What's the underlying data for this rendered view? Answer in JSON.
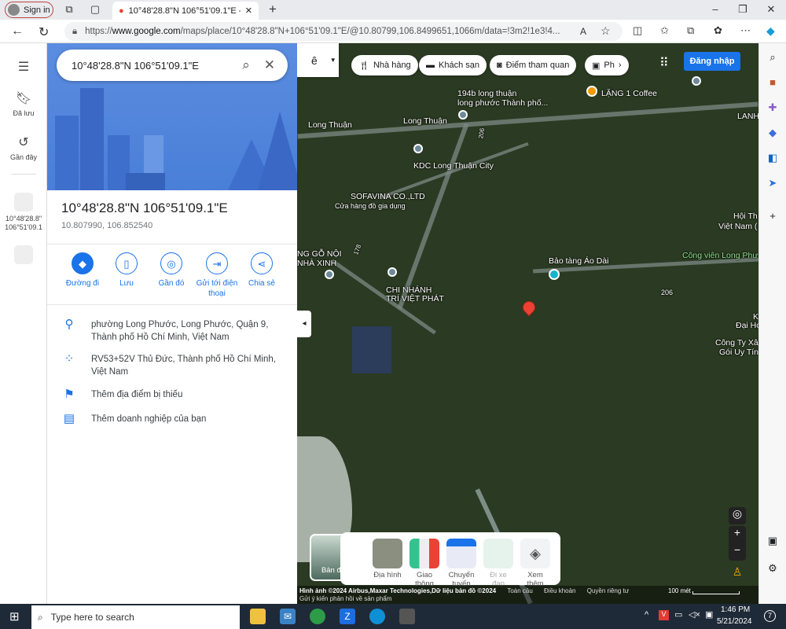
{
  "browser": {
    "signin": "Sign in",
    "tab_title": "10°48'28.8\"N 106°51'09.1\"E - Goo",
    "url_prefix": "https://",
    "url_domain": "www.google.com",
    "url_rest": "/maps/place/10°48'28.8\"N+106°51'09.1\"E/@10.80799,106.8499651,1066m/data=!3m2!1e3!4..."
  },
  "rail": {
    "saved": "Đã lưu",
    "recent": "Gần đây",
    "recent_item": "10°48'28.8\" 106°51'09.1"
  },
  "search": {
    "value": "10°48'28.8\"N 106°51'09.1\"E"
  },
  "place": {
    "title": "10°48'28.8\"N 106°51'09.1\"E",
    "coords": "10.807990, 106.852540"
  },
  "actions": [
    {
      "label": "Đường đi",
      "icon": "directions-icon"
    },
    {
      "label": "Lưu",
      "icon": "bookmark-icon"
    },
    {
      "label": "Gần đó",
      "icon": "nearby-icon"
    },
    {
      "label": "Gửi tới điện thoại",
      "icon": "send-to-phone-icon"
    },
    {
      "label": "Chia sẻ",
      "icon": "share-icon"
    }
  ],
  "info": {
    "address": "phường Long Phước, Long Phước, Quận 9, Thành phố Hồ Chí Minh, Việt Nam",
    "pluscode": "RV53+52V Thủ Đức, Thành phố Hồ Chí Minh, Việt Nam",
    "add_place": "Thêm địa điểm bị thiếu",
    "add_business": "Thêm doanh nghiệp của bạn"
  },
  "map": {
    "lang_btn": "ê",
    "chips": [
      "Nhà hàng",
      "Khách sạn",
      "Điểm tham quan",
      "Ph"
    ],
    "login": "Đăng nhập",
    "labels": {
      "l1": "194b long thuận",
      "l2": "long phước Thành phố...",
      "coffee": "LẶNG 1 Coffee",
      "lt1": "Long Thuận",
      "lt2": "Long Thuận",
      "kdc": "KDC Long Thuận City",
      "sofa": "SOFAVINA CO.,LTD",
      "sofa2": "Cửa hàng đồ gia dụng",
      "r206a": "206",
      "r206b": "206",
      "r178": "178",
      "go": "NG GỖ NỘI",
      "xinh": "NHÀ XINH",
      "cn": "CHI NHÁNH",
      "tvp": "TRÍ VIỆT PHÁT",
      "bt": "Bảo tàng Áo Dài",
      "cv": "Công viên Long Phư",
      "hoi": "Hội Th",
      "vn": "Việt Nam (",
      "lanh": "LANH",
      "dai": "Đại Họ",
      "cty": "Công Ty Xâ",
      "goi": "Gói Uy Tín",
      "k": "K"
    },
    "basemap": "Bản đồ",
    "layers": [
      "Địa hình",
      "Giao thông",
      "Chuyển tuyến",
      "Đi xe đạp",
      "Xem thêm"
    ],
    "attribution": "Hình ảnh ©2024 Airbus,Maxar Technologies,Dữ liệu bản đồ ©2024",
    "links": [
      "Toàn cầu",
      "Điều khoản",
      "Quyền riêng tư"
    ],
    "feedback": "Gửi ý kiến phản hồi về sản phẩm",
    "scale": "100 mét"
  },
  "taskbar": {
    "search_placeholder": "Type here to search",
    "time": "1:46 PM",
    "date": "5/21/2024",
    "notif": "7"
  }
}
